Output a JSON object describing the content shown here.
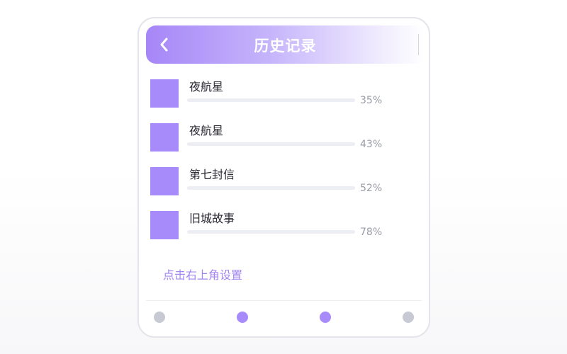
{
  "header": {
    "title": "历史记录",
    "back_icon": "chevron-left-icon"
  },
  "history": [
    {
      "title": "夜航星",
      "progress_label": "35%",
      "progress": 0.35
    },
    {
      "title": "夜航星",
      "progress_label": "43%",
      "progress": 0.43
    },
    {
      "title": "第七封信",
      "progress_label": "52%",
      "progress": 0.52
    },
    {
      "title": "旧城故事",
      "progress_label": "78%",
      "progress": 0.78
    }
  ],
  "hint": "点击右上角设置",
  "pager": {
    "dots": [
      {
        "state": "inactive",
        "color": "#c7cad2"
      },
      {
        "state": "active",
        "color": "#a78bfa"
      },
      {
        "state": "active",
        "color": "#a78bfa"
      },
      {
        "state": "inactive",
        "color": "#c7cad2"
      }
    ]
  },
  "colors": {
    "accent": "#a78bfa",
    "cover": "#a78bfa",
    "track": "#eceef3",
    "percent_text": "#9a9ca6"
  }
}
